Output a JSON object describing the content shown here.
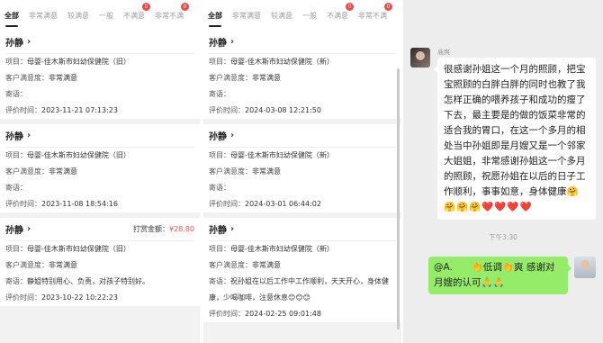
{
  "tabs": [
    {
      "label": "全部",
      "active": true
    },
    {
      "label": "非常满意"
    },
    {
      "label": "较满意"
    },
    {
      "label": "一般"
    },
    {
      "label": "不满意",
      "badge": "0"
    },
    {
      "label": "非常不满",
      "badge": "0"
    }
  ],
  "labels": {
    "project": "项目：",
    "satisfaction": "客户满意度：",
    "message": "寄语：",
    "time": "评价时间：",
    "reward": "打赏金额："
  },
  "left_cards": [
    {
      "name": "孙静",
      "project": "母婴-佳木斯市妇幼保健院（旧）",
      "satisfaction": "非常满意",
      "message": "",
      "time": "2023-11-21 07:13:23"
    },
    {
      "name": "孙静",
      "project": "母婴-佳木斯市妇幼保健院（旧）",
      "satisfaction": "非常满意",
      "message": "",
      "time": "2023-11-08 18:54:16"
    },
    {
      "name": "孙静",
      "reward": "¥28.80",
      "project": "母婴-佳木斯市妇幼保健院（旧）",
      "satisfaction": "非常满意",
      "message": "静姐特别用心、负责，对孩子特别好。",
      "time": "2023-10-22 10:22:23"
    }
  ],
  "mid_cards": [
    {
      "name": "孙静",
      "project": "母婴-佳木斯市妇幼保健院（新）",
      "satisfaction": "非常满意",
      "message": "",
      "time": "2024-03-08 12:21:50"
    },
    {
      "name": "孙静",
      "project": "母婴-佳木斯市妇幼保健院（新）",
      "satisfaction": "非常满意",
      "message": "",
      "time": "2024-03-01 06:44:02"
    },
    {
      "name": "孙静",
      "project": "母婴-佳木斯市妇幼保健院（新）",
      "satisfaction": "非常满意",
      "message_line1": "祝孙姐在以后工作中工作顺利，天天开心，身体健",
      "message_line2": "康，少喝咖啡，注意休息😊😊😊",
      "time": "2024-02-25 09:01:48"
    }
  ],
  "chat": {
    "sender": "庙爽",
    "incoming": "很感谢孙姐这一个月的照顾，把宝宝照顾的白胖白胖的同时也教了我怎样正确的喂养孩子和成功的瘦了下去，最主要是的做的饭菜非常的适合我的胃口，在这一个多月的相处当中孙姐即是月嫂又是一个邻家大姐姐，非常感谢孙姐这一个多月的照顾，祝愿孙姐在以后的日子工作顺利，事事如意，身体健康",
    "incoming_emojis": "🤗🤗🤗🤗❤️❤️❤️❤️",
    "time": "下午3:30",
    "outgoing": "@A.　　👏低调👏爽 感谢对月嫂的认可🙏🙏"
  }
}
